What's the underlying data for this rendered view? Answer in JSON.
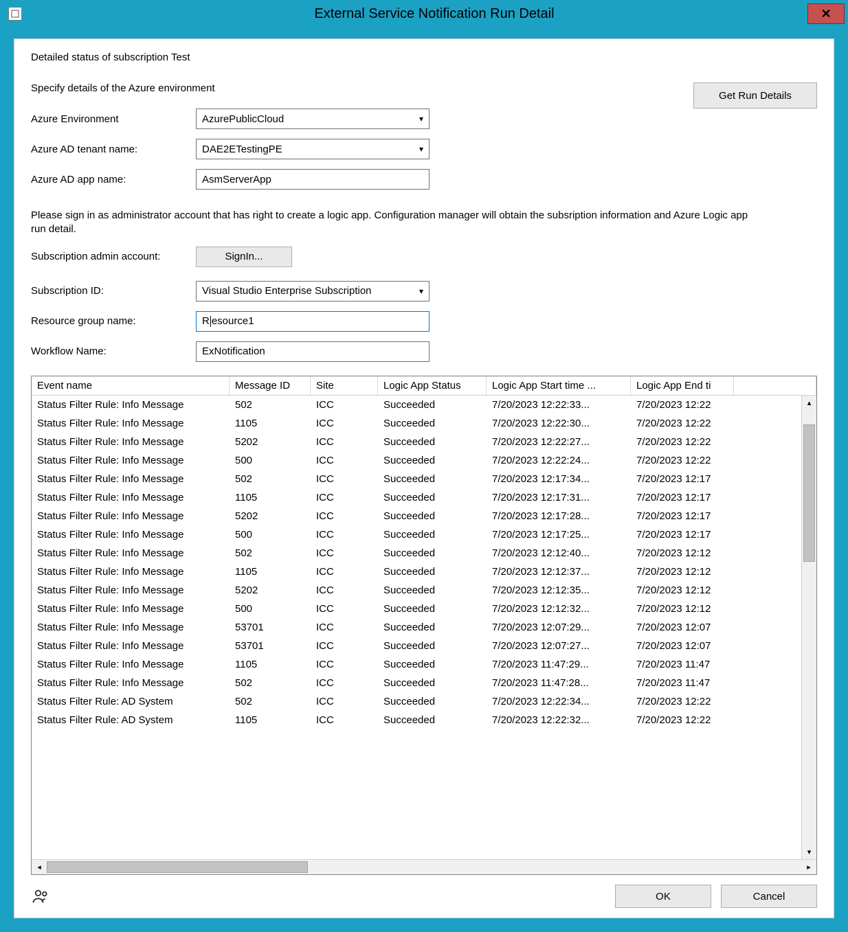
{
  "window": {
    "title": "External Service Notification Run Detail"
  },
  "heading": "Detailed status of subscription Test",
  "section_label": "Specify details of the Azure environment",
  "get_run_details_label": "Get Run Details",
  "labels": {
    "azure_env": "Azure Environment",
    "tenant": "Azure AD tenant name:",
    "app": "Azure AD app name:",
    "admin_acct": "Subscription admin account:",
    "sub_id": "Subscription ID:",
    "rg": "Resource group name:",
    "workflow": "Workflow Name:"
  },
  "values": {
    "azure_env": "AzurePublicCloud",
    "tenant": "DAE2ETestingPE",
    "app": "AsmServerApp",
    "sub_id": "Visual Studio Enterprise Subscription",
    "rg_prefix": "R",
    "rg_suffix": "esource1",
    "workflow": "ExNotification"
  },
  "signin_label": "SignIn...",
  "note": "Please sign in as administrator account that has right to create a logic app. Configuration manager will obtain the subsription information and Azure Logic app run detail.",
  "columns": {
    "event": "Event name",
    "msg": "Message ID",
    "site": "Site",
    "status": "Logic App Status",
    "start": "Logic App Start time ...",
    "end": "Logic App End ti"
  },
  "rows": [
    {
      "event": "Status Filter Rule: Info Message",
      "msg": "502",
      "site": "ICC",
      "status": "Succeeded",
      "start": "7/20/2023 12:22:33...",
      "end": "7/20/2023 12:22"
    },
    {
      "event": "Status Filter Rule: Info Message",
      "msg": "1105",
      "site": "ICC",
      "status": "Succeeded",
      "start": "7/20/2023 12:22:30...",
      "end": "7/20/2023 12:22"
    },
    {
      "event": "Status Filter Rule: Info Message",
      "msg": "5202",
      "site": "ICC",
      "status": "Succeeded",
      "start": "7/20/2023 12:22:27...",
      "end": "7/20/2023 12:22"
    },
    {
      "event": "Status Filter Rule: Info Message",
      "msg": "500",
      "site": "ICC",
      "status": "Succeeded",
      "start": "7/20/2023 12:22:24...",
      "end": "7/20/2023 12:22"
    },
    {
      "event": "Status Filter Rule: Info Message",
      "msg": "502",
      "site": "ICC",
      "status": "Succeeded",
      "start": "7/20/2023 12:17:34...",
      "end": "7/20/2023 12:17"
    },
    {
      "event": "Status Filter Rule: Info Message",
      "msg": "1105",
      "site": "ICC",
      "status": "Succeeded",
      "start": "7/20/2023 12:17:31...",
      "end": "7/20/2023 12:17"
    },
    {
      "event": "Status Filter Rule: Info Message",
      "msg": "5202",
      "site": "ICC",
      "status": "Succeeded",
      "start": "7/20/2023 12:17:28...",
      "end": "7/20/2023 12:17"
    },
    {
      "event": "Status Filter Rule: Info Message",
      "msg": "500",
      "site": "ICC",
      "status": "Succeeded",
      "start": "7/20/2023 12:17:25...",
      "end": "7/20/2023 12:17"
    },
    {
      "event": "Status Filter Rule: Info Message",
      "msg": "502",
      "site": "ICC",
      "status": "Succeeded",
      "start": "7/20/2023 12:12:40...",
      "end": "7/20/2023 12:12"
    },
    {
      "event": "Status Filter Rule: Info Message",
      "msg": "1105",
      "site": "ICC",
      "status": "Succeeded",
      "start": "7/20/2023 12:12:37...",
      "end": "7/20/2023 12:12"
    },
    {
      "event": "Status Filter Rule: Info Message",
      "msg": "5202",
      "site": "ICC",
      "status": "Succeeded",
      "start": "7/20/2023 12:12:35...",
      "end": "7/20/2023 12:12"
    },
    {
      "event": "Status Filter Rule: Info Message",
      "msg": "500",
      "site": "ICC",
      "status": "Succeeded",
      "start": "7/20/2023 12:12:32...",
      "end": "7/20/2023 12:12"
    },
    {
      "event": "Status Filter Rule: Info Message",
      "msg": "53701",
      "site": "ICC",
      "status": "Succeeded",
      "start": "7/20/2023 12:07:29...",
      "end": "7/20/2023 12:07"
    },
    {
      "event": "Status Filter Rule: Info Message",
      "msg": "53701",
      "site": "ICC",
      "status": "Succeeded",
      "start": "7/20/2023 12:07:27...",
      "end": "7/20/2023 12:07"
    },
    {
      "event": "Status Filter Rule: Info Message",
      "msg": "1105",
      "site": "ICC",
      "status": "Succeeded",
      "start": "7/20/2023 11:47:29...",
      "end": "7/20/2023 11:47"
    },
    {
      "event": "Status Filter Rule: Info Message",
      "msg": "502",
      "site": "ICC",
      "status": "Succeeded",
      "start": "7/20/2023 11:47:28...",
      "end": "7/20/2023 11:47"
    },
    {
      "event": "Status Filter Rule: AD System",
      "msg": "502",
      "site": "ICC",
      "status": "Succeeded",
      "start": "7/20/2023 12:22:34...",
      "end": "7/20/2023 12:22"
    },
    {
      "event": "Status Filter Rule: AD System",
      "msg": "1105",
      "site": "ICC",
      "status": "Succeeded",
      "start": "7/20/2023 12:22:32...",
      "end": "7/20/2023 12:22"
    }
  ],
  "footer": {
    "ok": "OK",
    "cancel": "Cancel"
  }
}
